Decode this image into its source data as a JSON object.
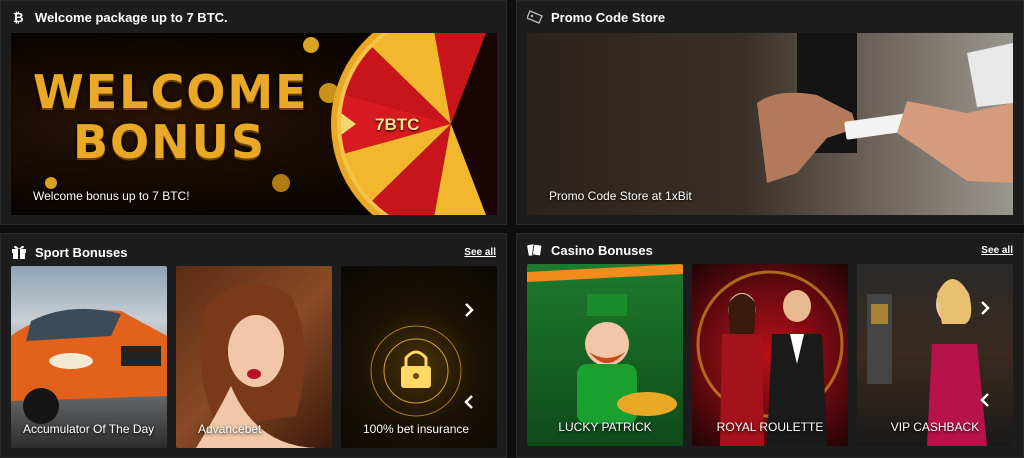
{
  "welcome": {
    "title": "Welcome package up to 7 BTC.",
    "banner_heading_line1": "WELCOME",
    "banner_heading_line2": "BONUS",
    "wheel_label": "7BTC",
    "caption": "Welcome bonus up to 7 BTC!"
  },
  "promo": {
    "title": "Promo Code Store",
    "caption": "Promo Code Store at 1xBit"
  },
  "sport": {
    "title": "Sport Bonuses",
    "see_all": "See all",
    "cards": [
      {
        "label": "Accumulator Of The Day"
      },
      {
        "label": "Advancebet"
      },
      {
        "label": "100% bet insurance"
      }
    ]
  },
  "casino": {
    "title": "Casino Bonuses",
    "see_all": "See all",
    "cards": [
      {
        "label": "LUCKY PATRICK"
      },
      {
        "label": "ROYAL ROULETTE"
      },
      {
        "label": "VIP CASHBACK"
      }
    ]
  },
  "icons": {
    "welcome": "bitcoin-icon",
    "promo": "ticket-icon",
    "sport": "gift-icon",
    "casino": "cards-icon",
    "next": "chevron-right-icon",
    "prev": "chevron-left-icon"
  },
  "colors": {
    "panel_bg": "#1d1d1d",
    "page_bg": "#0f0f0f",
    "gold": "#e9a826",
    "wheel_red": "#c8151b"
  }
}
